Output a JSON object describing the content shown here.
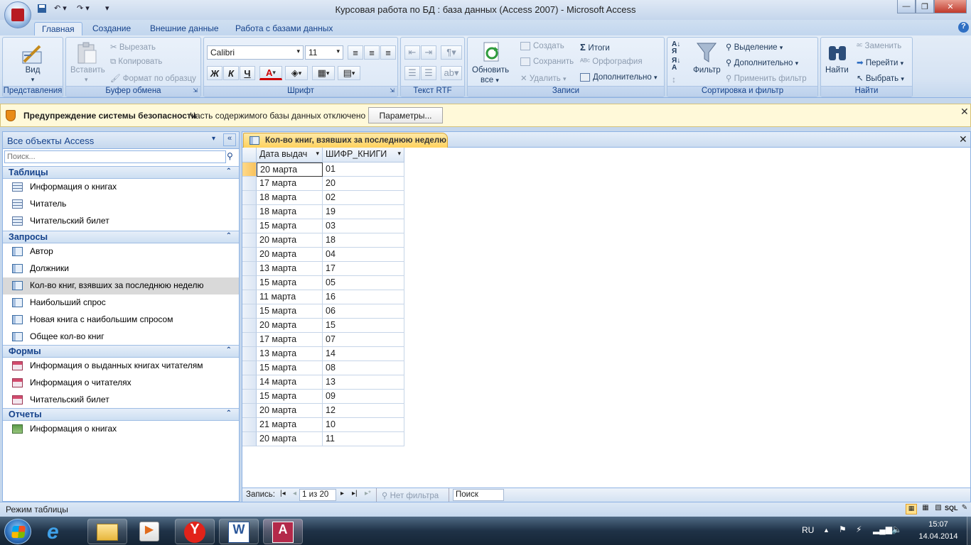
{
  "window": {
    "title": "Курсовая работа по БД : база данных (Access 2007)  -  Microsoft Access"
  },
  "ribbon_tabs": [
    "Главная",
    "Создание",
    "Внешние данные",
    "Работа с базами данных"
  ],
  "ribbon": {
    "view": {
      "label": "Вид",
      "group": "Представления"
    },
    "clipboard": {
      "paste": "Вставить",
      "cut": "Вырезать",
      "copy": "Копировать",
      "format_painter": "Формат по образцу",
      "group": "Буфер обмена"
    },
    "font": {
      "name": "Calibri",
      "size": "11",
      "bold": "Ж",
      "italic": "К",
      "underline": "Ч",
      "font_color": "A",
      "group": "Шрифт"
    },
    "rtf": {
      "group": "Текст RTF"
    },
    "records": {
      "refresh": "Обновить",
      "refresh2": "все",
      "create": "Создать",
      "save": "Сохранить",
      "delete": "Удалить",
      "totals": "Итоги",
      "spelling": "Орфография",
      "more": "Дополнительно",
      "group": "Записи"
    },
    "sort": {
      "filter": "Фильтр",
      "selection": "Выделение",
      "advanced": "Дополнительно",
      "apply_filter": "Применить фильтр",
      "group": "Сортировка и фильтр"
    },
    "find": {
      "find": "Найти",
      "replace": "Заменить",
      "goto": "Перейти",
      "select": "Выбрать",
      "group": "Найти"
    }
  },
  "security_bar": {
    "title": "Предупреждение системы безопасности",
    "message": "Часть содержимого базы данных отключено",
    "button": "Параметры..."
  },
  "nav": {
    "title": "Все объекты Access",
    "search_placeholder": "Поиск...",
    "sections": [
      {
        "title": "Таблицы",
        "items": [
          "Информация о книгах",
          "Читатель",
          "Читательский билет"
        ]
      },
      {
        "title": "Запросы",
        "items": [
          "Автор",
          "Должники",
          "Кол-во книг, взявших за последнюю неделю",
          "Наибольший спрос",
          "Новая книга с наибольшим спросом",
          "Общее кол-во книг"
        ]
      },
      {
        "title": "Формы",
        "items": [
          "Информация о выданных книгах читателям",
          "Информация о читателях",
          "Читательский билет"
        ]
      },
      {
        "title": "Отчеты",
        "items": [
          "Информация о книгах"
        ]
      }
    ]
  },
  "document": {
    "tab_title": "Кол-во книг, взявших за последнюю неделю",
    "columns": [
      "Дата выдач",
      "ШИФР_КНИГИ"
    ],
    "rows": [
      [
        "20 марта",
        "01"
      ],
      [
        "17 марта",
        "20"
      ],
      [
        "18 марта",
        "02"
      ],
      [
        "18 марта",
        "19"
      ],
      [
        "15 марта",
        "03"
      ],
      [
        "20 марта",
        "18"
      ],
      [
        "20 марта",
        "04"
      ],
      [
        "13 марта",
        "17"
      ],
      [
        "15 марта",
        "05"
      ],
      [
        "11 марта",
        "16"
      ],
      [
        "15 марта",
        "06"
      ],
      [
        "20 марта",
        "15"
      ],
      [
        "17 марта",
        "07"
      ],
      [
        "13 марта",
        "14"
      ],
      [
        "15 марта",
        "08"
      ],
      [
        "14 марта",
        "13"
      ],
      [
        "15 марта",
        "09"
      ],
      [
        "20 марта",
        "12"
      ],
      [
        "21 марта",
        "10"
      ],
      [
        "20 марта",
        "11"
      ]
    ]
  },
  "record_nav": {
    "label": "Запись:",
    "position": "1 из 20",
    "no_filter": "Нет фильтра",
    "search": "Поиск"
  },
  "status": {
    "text": "Режим таблицы",
    "sql": "SQL"
  },
  "taskbar": {
    "lang": "RU",
    "time": "15:07",
    "date": "14.04.2014"
  }
}
